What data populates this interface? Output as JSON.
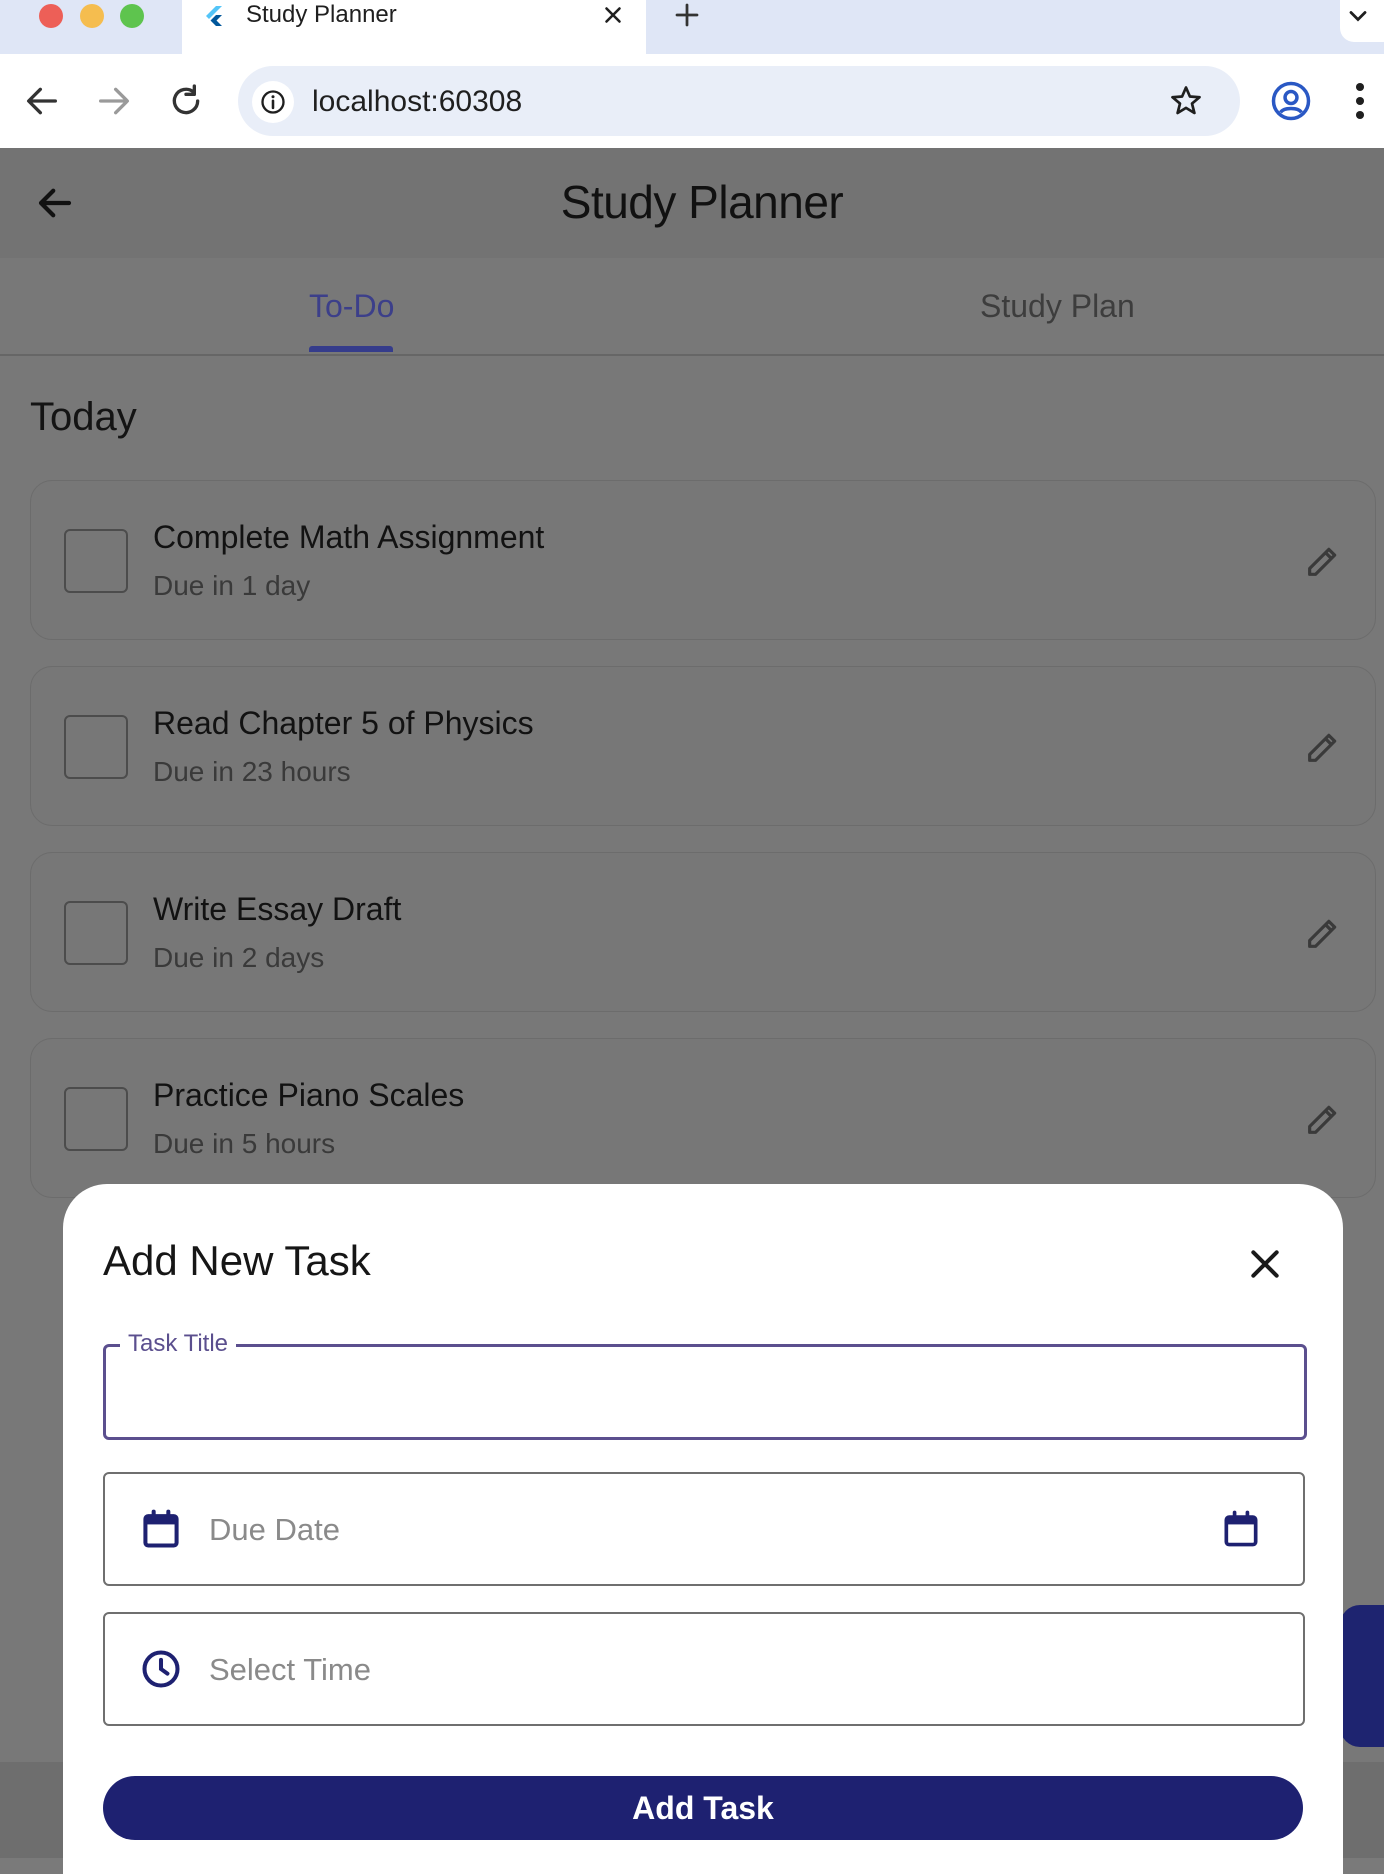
{
  "browser": {
    "tab_title": "Study Planner",
    "url": "localhost:60308",
    "icons": [
      "flutter-favicon-icon",
      "close-icon",
      "plus-icon",
      "chevron-down-icon",
      "back-icon",
      "forward-icon",
      "reload-icon",
      "info-icon",
      "star-icon",
      "profile-icon",
      "more-vert-icon"
    ]
  },
  "app": {
    "title": "Study Planner",
    "tabs": [
      {
        "label": "To-Do",
        "selected": true
      },
      {
        "label": "Study Plan",
        "selected": false
      }
    ],
    "section_title": "Today",
    "tasks": [
      {
        "title": "Complete Math Assignment",
        "due": "Due in 1 day",
        "done": false
      },
      {
        "title": "Read Chapter 5 of Physics",
        "due": "Due in 23 hours",
        "done": false
      },
      {
        "title": "Write Essay Draft",
        "due": "Due in 2 days",
        "done": false
      },
      {
        "title": "Practice Piano Scales",
        "due": "Due in 5 hours",
        "done": false
      }
    ]
  },
  "sheet": {
    "title": "Add New Task",
    "task_title_label": "Task Title",
    "task_title_value": "",
    "due_date_placeholder": "Due Date",
    "time_placeholder": "Select Time",
    "submit_label": "Add Task"
  },
  "colors": {
    "accent": "#1e2171",
    "tab_selected": "#3c3f8a",
    "focus_outline": "#5b4f8e",
    "scrim": "#787878"
  }
}
